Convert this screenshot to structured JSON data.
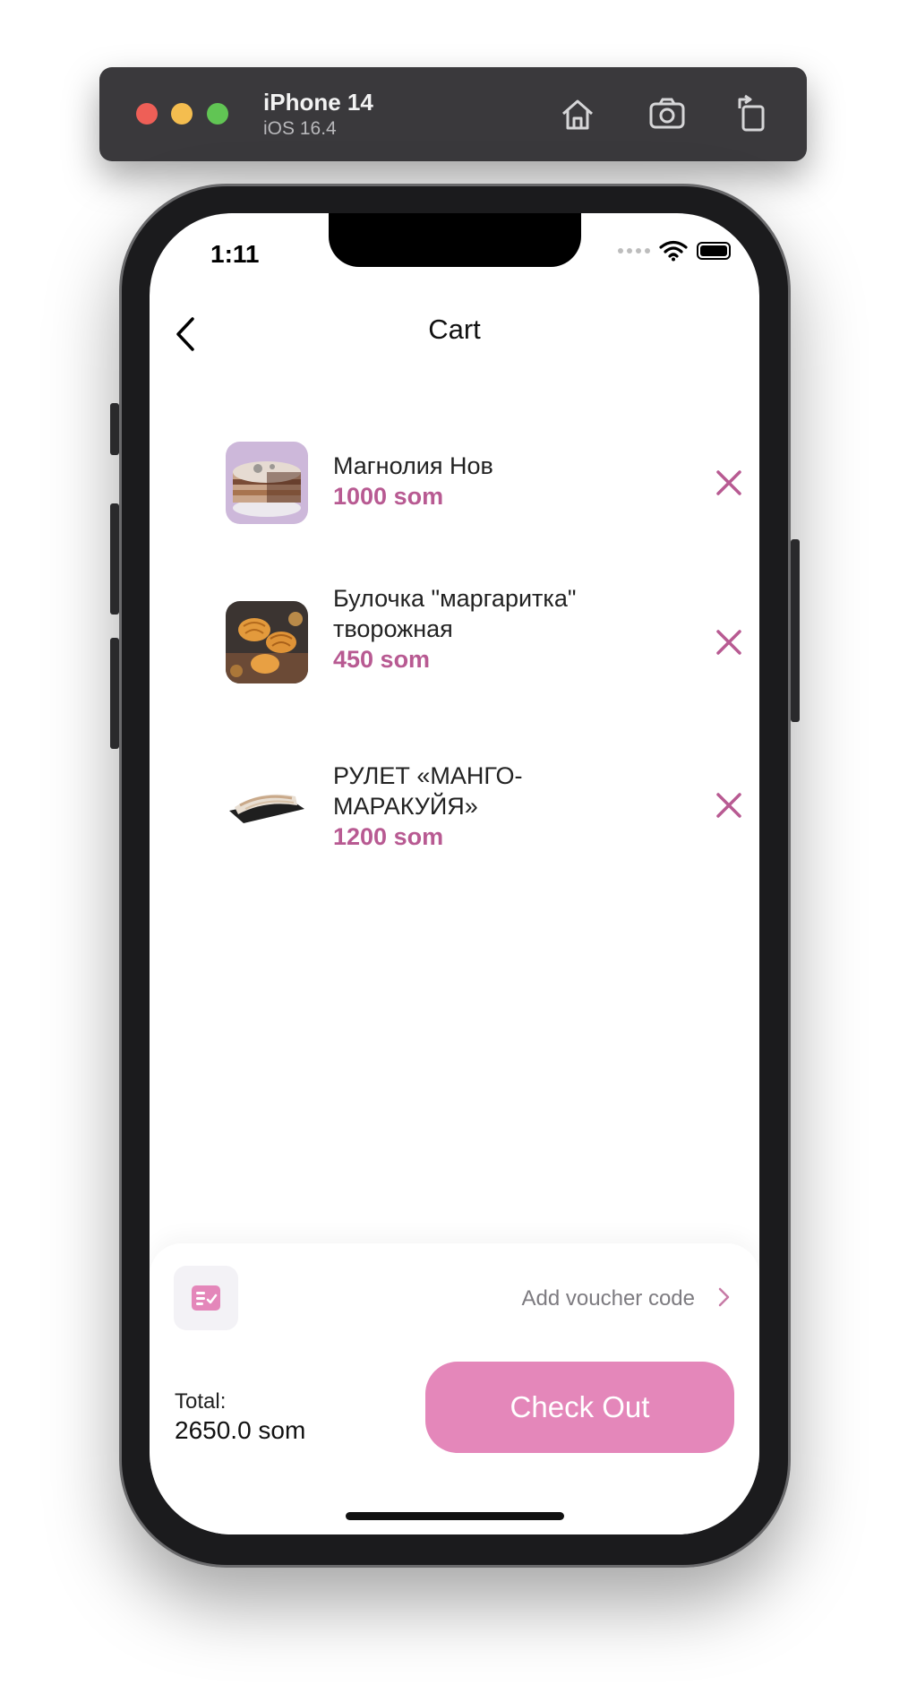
{
  "simulator": {
    "device_name": "iPhone 14",
    "os_version": "iOS 16.4"
  },
  "status_bar": {
    "time": "1:11"
  },
  "header": {
    "title": "Cart"
  },
  "cart_items": [
    {
      "name": "Магнолия Нов",
      "price": "1000 som",
      "image": "layered-cake-photo"
    },
    {
      "name": "Булочка \"маргаритка\" творожная",
      "price": "450 som",
      "image": "pastry-buns-photo"
    },
    {
      "name": "РУЛЕТ «МАНГО-МАРАКУЙЯ»",
      "price": "1200 som",
      "image": "roll-cake-photo"
    }
  ],
  "footer": {
    "voucher_label": "Add voucher code",
    "total_label": "Total:",
    "total_value": "2650.0 som",
    "checkout_label": "Check Out"
  },
  "colors": {
    "accent": "#b85a92",
    "checkout_button": "#e487ba",
    "voucher_icon": "#e487ba"
  }
}
